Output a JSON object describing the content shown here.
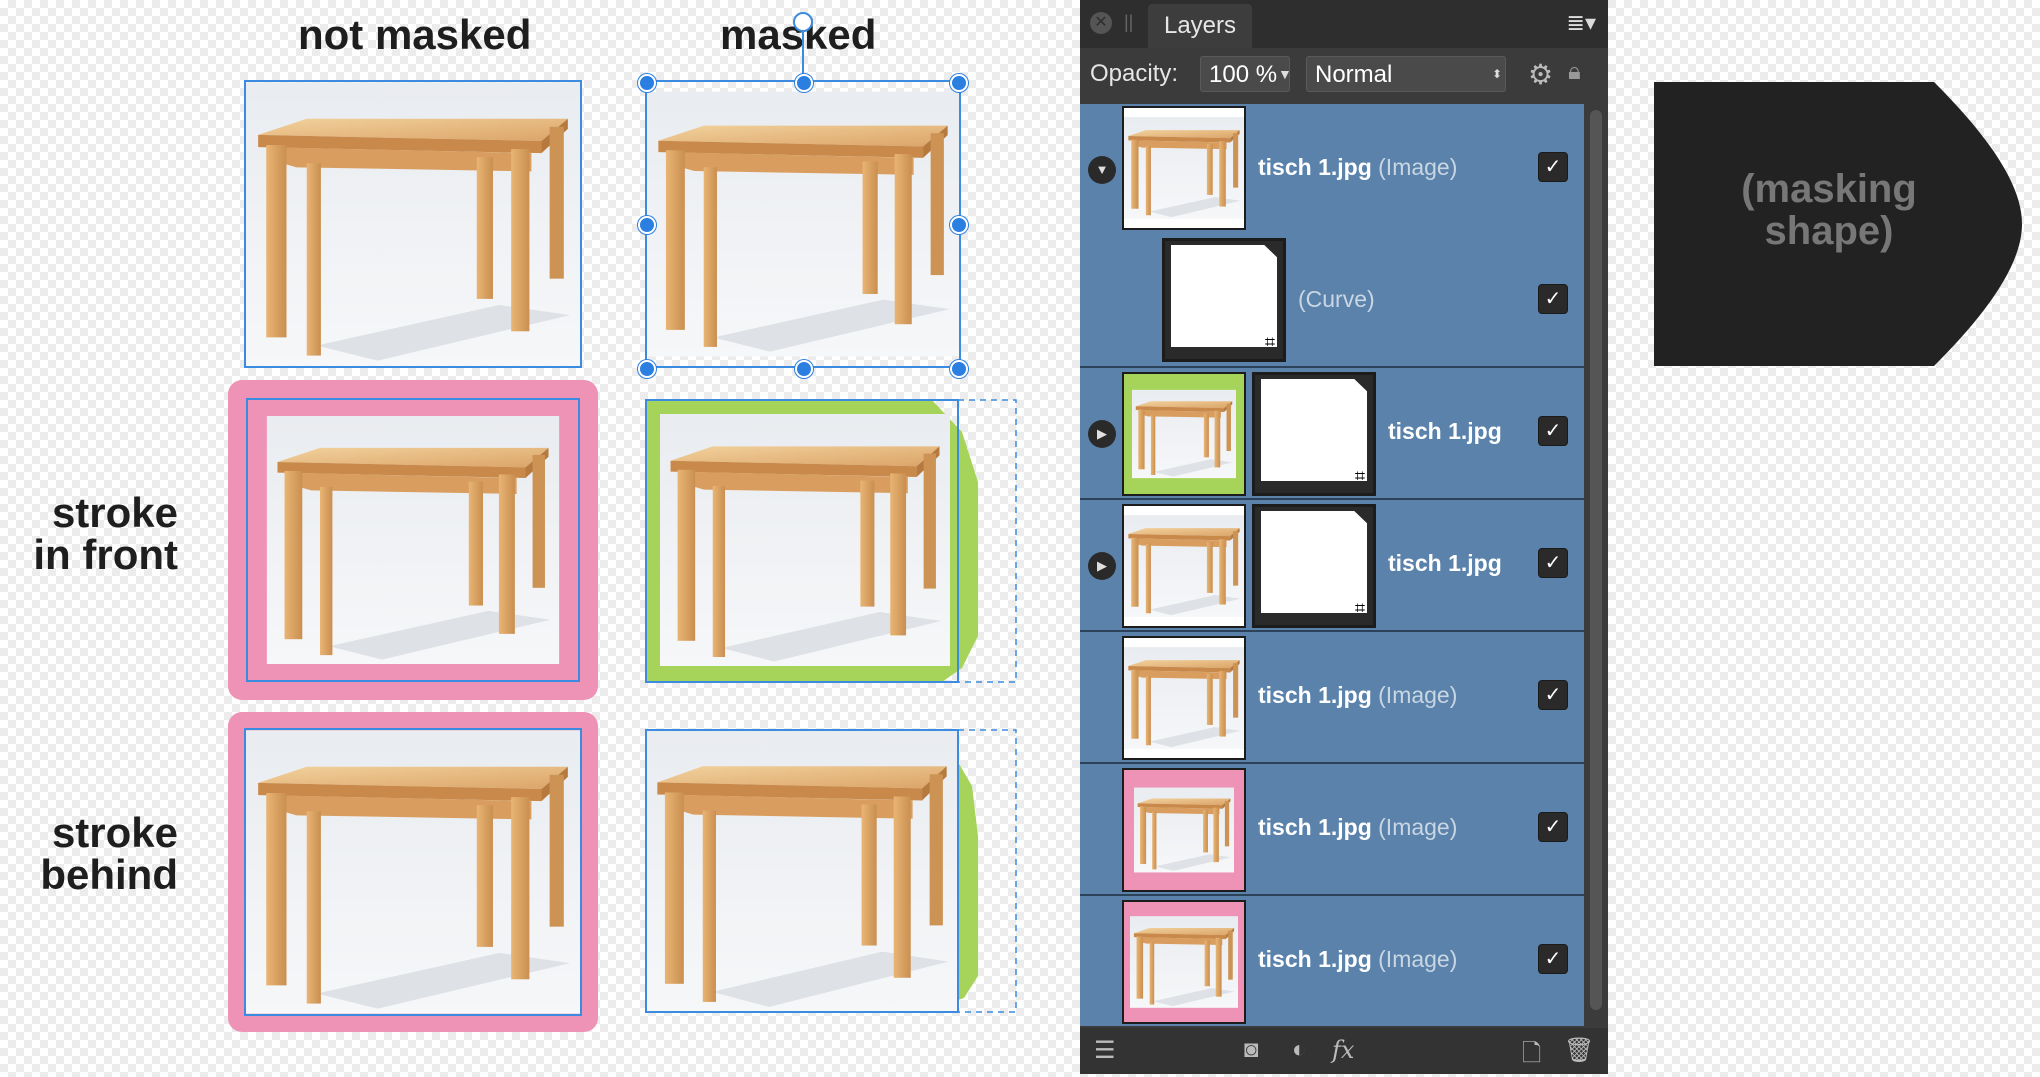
{
  "columns": {
    "not_masked": "not masked",
    "masked": "masked"
  },
  "rows": {
    "stroke_front": [
      "stroke",
      "in front"
    ],
    "stroke_behind": [
      "stroke",
      "behind"
    ]
  },
  "panel": {
    "tab": "Layers",
    "opacity_label": "Opacity:",
    "opacity_value": "100 %",
    "blend_mode": "Normal",
    "layers": [
      {
        "name": "tisch 1.jpg",
        "type": "(Image)",
        "expanded": true,
        "checked": "✓"
      },
      {
        "name": "",
        "type": "(Curve)",
        "child": true,
        "checked": "✓"
      },
      {
        "name": "tisch 1.jpg",
        "type": "",
        "mask": true,
        "stroke": "green",
        "checked": "✓"
      },
      {
        "name": "tisch 1.jpg",
        "type": "",
        "mask": true,
        "checked": "✓"
      },
      {
        "name": "tisch 1.jpg",
        "type": "(Image)",
        "checked": "✓"
      },
      {
        "name": "tisch 1.jpg",
        "type": "(Image)",
        "stroke": "pink",
        "checked": "✓"
      },
      {
        "name": "tisch 1.jpg",
        "type": "(Image)",
        "stroke": "pink",
        "checked": "✓"
      }
    ]
  },
  "masking_shape_label": "(masking shape)",
  "colors": {
    "pink": "#ee93b5",
    "green": "#a6d45a",
    "selection": "#3b8be0",
    "layer_bg": "#5a82aa",
    "shape": "#222222"
  }
}
